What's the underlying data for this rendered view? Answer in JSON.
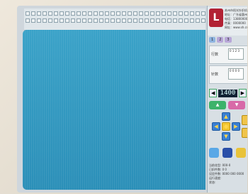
{
  "brand": {
    "logo_text": "L",
    "lines": [
      "苏州市阳光针织机械有限公司",
      "地址：广东省惠州市",
      "电话：1380000000",
      "传真：0000000",
      "网址：www.sh.cn"
    ]
  },
  "tabs": [
    "1",
    "2",
    "3"
  ],
  "fields": [
    {
      "label": "行数",
      "value": "0 1\n2 3"
    },
    {
      "label": "针数",
      "value": "0 0\n0 0"
    }
  ],
  "counter": {
    "value": "1400",
    "left_icon": "◀",
    "right_icon": "▶"
  },
  "buttons_row1": [
    {
      "label": "▲",
      "color": "green"
    },
    {
      "label": "▼",
      "color": "pink"
    }
  ],
  "dpad": {
    "up": "▲",
    "down": "▼",
    "left": "◀",
    "right": "▶",
    "center": "●"
  },
  "info_lines": [
    "当前花型: 000-0",
    "已织件数: 0 0",
    "设定件数: 0000 000 0000",
    "运行速度:",
    "状态:"
  ]
}
